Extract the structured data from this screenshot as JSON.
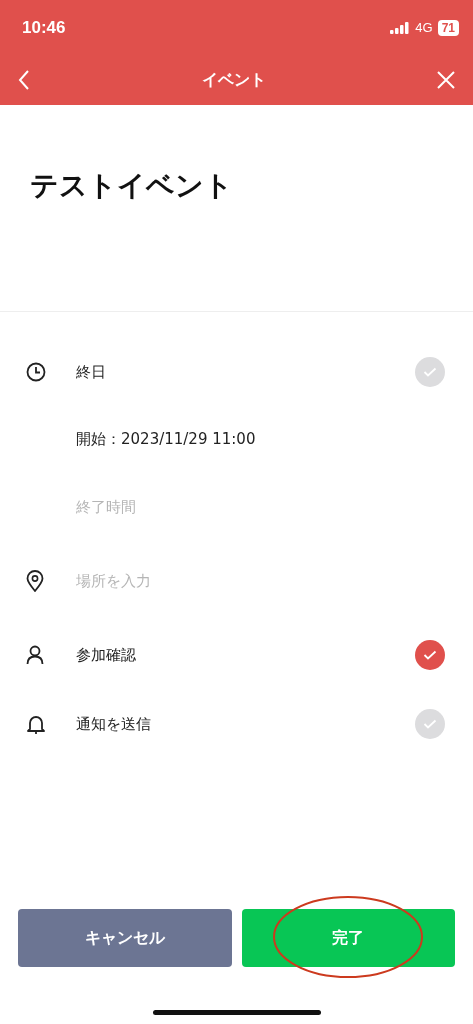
{
  "status_bar": {
    "time": "10:46",
    "network": "4G",
    "battery": "71"
  },
  "nav": {
    "title": "イベント"
  },
  "event_title": "テストイベント",
  "rows": [
    {
      "kind": "toggle",
      "label": "終日",
      "checked": false
    },
    {
      "kind": "value",
      "text": "開始：2023/11/29 11:00"
    },
    {
      "kind": "placeholder",
      "placeholder": "終了時間"
    },
    {
      "kind": "field",
      "placeholder": "場所を入力"
    },
    {
      "kind": "toggle",
      "label": "参加確認",
      "checked": true
    },
    {
      "kind": "toggle",
      "label": "通知を送信",
      "checked": false
    }
  ],
  "buttons": [
    {
      "kind": "cancel",
      "label": "キャンセル"
    },
    {
      "kind": "done",
      "label": "完了"
    }
  ]
}
